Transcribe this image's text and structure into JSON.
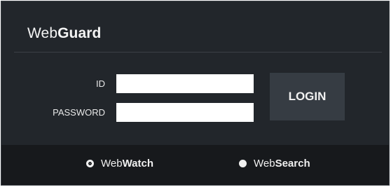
{
  "app": {
    "title_prefix": "Web",
    "title_bold": "Guard"
  },
  "form": {
    "id_label": "ID",
    "id_value": "",
    "password_label": "PASSWORD",
    "password_value": "",
    "login_label": "LOGIN"
  },
  "modes": [
    {
      "prefix": "Web",
      "bold": "Watch",
      "selected": true
    },
    {
      "prefix": "Web",
      "bold": "Search",
      "selected": false
    }
  ],
  "colors": {
    "panel_bg": "#22262b",
    "footer_bg": "#17191c",
    "button_bg": "#363c43",
    "text": "#f0f0f0"
  }
}
